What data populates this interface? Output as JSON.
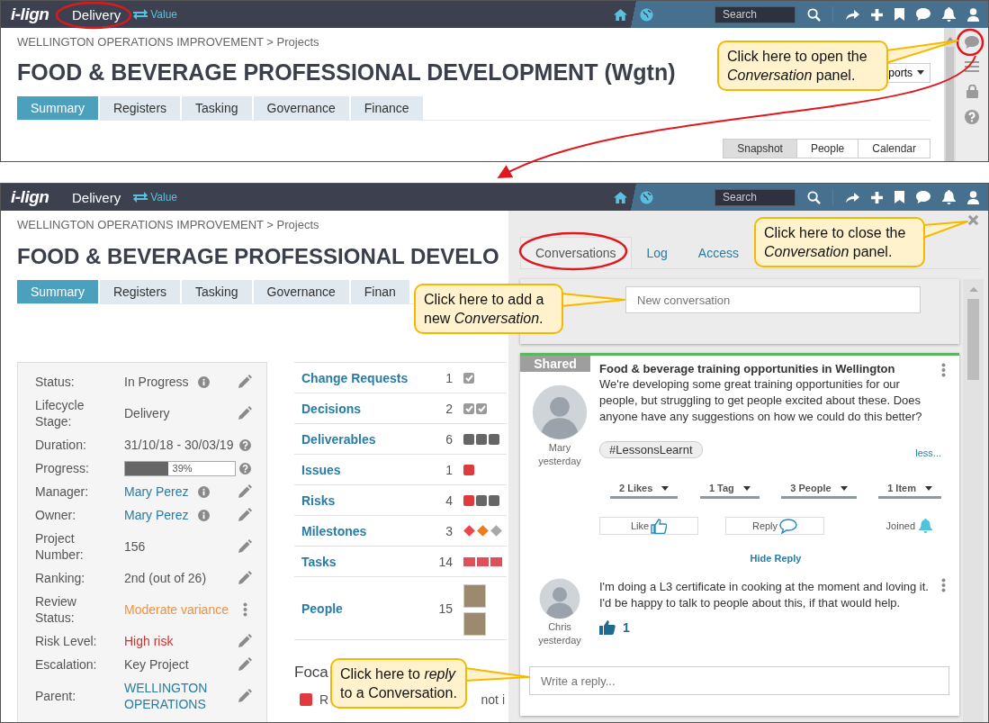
{
  "top_screen": {
    "app_bar": {
      "logo": "i-lign",
      "module": "Delivery",
      "switch_label": "Value",
      "search_placeholder": "Search"
    },
    "breadcrumb": "WELLINGTON OPERATIONS IMPROVEMENT > Projects",
    "title": "FOOD & BEVERAGE PROFESSIONAL DEVELOPMENT (Wgtn)",
    "reports_button": "ports",
    "tabs": [
      {
        "label": "Summary",
        "selected": true
      },
      {
        "label": "Registers",
        "selected": false
      },
      {
        "label": "Tasking",
        "selected": false
      },
      {
        "label": "Governance",
        "selected": false
      },
      {
        "label": "Finance",
        "selected": false
      }
    ],
    "view_buttons": [
      {
        "label": "Snapshot",
        "selected": true
      },
      {
        "label": "People",
        "selected": false
      },
      {
        "label": "Calendar",
        "selected": false
      }
    ]
  },
  "bottom_screen": {
    "app_bar": {
      "logo": "i-lign",
      "module": "Delivery",
      "switch_label": "Value",
      "search_placeholder": "Search"
    },
    "breadcrumb": "WELLINGTON OPERATIONS IMPROVEMENT > Projects",
    "title": "FOOD & BEVERAGE PROFESSIONAL DEVELO",
    "tabs": [
      {
        "label": "Summary",
        "selected": true
      },
      {
        "label": "Registers",
        "selected": false
      },
      {
        "label": "Tasking",
        "selected": false
      },
      {
        "label": "Governance",
        "selected": false
      },
      {
        "label": "Finan",
        "selected": false
      }
    ],
    "details": [
      {
        "label": "Status:",
        "kind": "text",
        "value": "In Progress",
        "color": "#555555",
        "info": true,
        "editable": true,
        "help": false,
        "more": false
      },
      {
        "label": "Lifecycle Stage:",
        "kind": "text",
        "value": "Delivery",
        "color": "#555555",
        "info": false,
        "editable": true,
        "help": false,
        "more": false
      },
      {
        "label": "Duration:",
        "kind": "text",
        "value": "31/10/18 - 30/03/19",
        "color": "#555555",
        "info": false,
        "editable": false,
        "help": true,
        "more": false
      },
      {
        "label": "Progress:",
        "kind": "progress",
        "level": 0.39,
        "value": "39%",
        "info": false,
        "editable": false,
        "help": true,
        "more": false
      },
      {
        "label": "Manager:",
        "kind": "text",
        "value": "Mary Perez",
        "color": "#2a7ca3",
        "info": true,
        "editable": true,
        "help": false,
        "more": false
      },
      {
        "label": "Owner:",
        "kind": "text",
        "value": "Mary Perez",
        "color": "#2a7ca3",
        "info": true,
        "editable": true,
        "help": false,
        "more": false
      },
      {
        "label": "Project Number:",
        "kind": "text",
        "value": "156",
        "color": "#555555",
        "info": false,
        "editable": true,
        "help": false,
        "more": false
      },
      {
        "label": "Ranking:",
        "kind": "text",
        "value": "2nd (out of 26)",
        "color": "#555555",
        "info": false,
        "editable": true,
        "help": false,
        "more": false
      },
      {
        "label": "Review Status:",
        "kind": "text",
        "value": "Moderate variance",
        "color": "#f4913c",
        "info": false,
        "editable": false,
        "help": false,
        "more": true
      },
      {
        "label": "Risk Level:",
        "kind": "text",
        "value": "High risk",
        "color": "#d0302f",
        "info": false,
        "editable": true,
        "help": false,
        "more": false
      },
      {
        "label": "Escalation:",
        "kind": "text",
        "value": "Key Project",
        "color": "#555555",
        "info": false,
        "editable": true,
        "help": false,
        "more": false
      },
      {
        "label": "Parent:",
        "kind": "text",
        "value": "WELLINGTON OPERATIONS",
        "color": "#2a7ca3",
        "info": false,
        "editable": true,
        "help": false,
        "more": false
      }
    ],
    "registers": [
      {
        "name": "Change Requests",
        "count": "1",
        "marks": [
          {
            "kind": "check",
            "color": "#9a9a9a"
          }
        ]
      },
      {
        "name": "Decisions",
        "count": "2",
        "marks": [
          {
            "kind": "check",
            "color": "#9a9a9a"
          },
          {
            "kind": "check",
            "color": "#9a9a9a"
          }
        ]
      },
      {
        "name": "Deliverables",
        "count": "6",
        "marks": [
          {
            "kind": "square",
            "color": "#666666"
          },
          {
            "kind": "square",
            "color": "#666666"
          },
          {
            "kind": "square",
            "color": "#666666"
          }
        ]
      },
      {
        "name": "Issues",
        "count": "1",
        "marks": [
          {
            "kind": "square",
            "color": "#e0393e"
          }
        ]
      },
      {
        "name": "Risks",
        "count": "4",
        "marks": [
          {
            "kind": "square",
            "color": "#e0393e"
          },
          {
            "kind": "square",
            "color": "#666666"
          },
          {
            "kind": "square",
            "color": "#666666"
          }
        ]
      },
      {
        "name": "Milestones",
        "count": "3",
        "marks": [
          {
            "kind": "diamond",
            "color": "#e8474d"
          },
          {
            "kind": "diamond",
            "color": "#f07b1a"
          },
          {
            "kind": "diamond",
            "color": "#a8a8a8"
          }
        ]
      },
      {
        "name": "Tasks",
        "count": "14",
        "marks": [
          {
            "kind": "bar",
            "color": "#e0505a"
          },
          {
            "kind": "bar",
            "color": "#e0505a"
          },
          {
            "kind": "bar",
            "color": "#e0505a"
          }
        ]
      },
      {
        "name": "People",
        "count": "15",
        "marks": [
          {
            "kind": "photo"
          },
          {
            "kind": "photo"
          }
        ]
      }
    ],
    "focus": {
      "heading": "Foca",
      "items": [
        {
          "color": "#e0393e",
          "text_start": "R",
          "text_end": "not i"
        }
      ]
    },
    "conversation_panel": {
      "tabs": [
        {
          "label": "Conversations",
          "selected": true
        },
        {
          "label": "Log",
          "selected": false
        },
        {
          "label": "Access",
          "selected": false
        }
      ],
      "new_conversation_placeholder": "New conversation",
      "post": {
        "badge": "Shared",
        "title": "Food & beverage training opportunities in Wellington",
        "body": "We're developing some great training opportunities for our people, but struggling to get people excited about these. Does anyone have any suggestions on how we could do this better?",
        "author": "Mary",
        "time": "yesterday",
        "tag": "#LessonsLearnt",
        "less_link": "less...",
        "filters": [
          "2 Likes",
          "1 Tag",
          "3 People",
          "1 Item"
        ],
        "actions": [
          {
            "label": "Like",
            "kind": "like"
          },
          {
            "label": "Reply",
            "kind": "reply"
          },
          {
            "label": "Joined",
            "kind": "joined"
          }
        ],
        "hide_reply": "Hide Reply",
        "reply": {
          "author": "Chris",
          "time": "yesterday",
          "body": "I'm doing a L3 certificate in cooking at the moment and loving it. I'd be happy to talk to people about this, if that would help.",
          "likes": "1"
        },
        "reply_placeholder": "Write a reply..."
      }
    }
  },
  "callouts": [
    {
      "text": "Click here to open the *Conversation* panel."
    },
    {
      "text": "Click here to close the *Conversation* panel."
    },
    {
      "text": "Click here to add a new *Conversation*."
    },
    {
      "text": "Click here to *reply* to a Conversation."
    }
  ]
}
